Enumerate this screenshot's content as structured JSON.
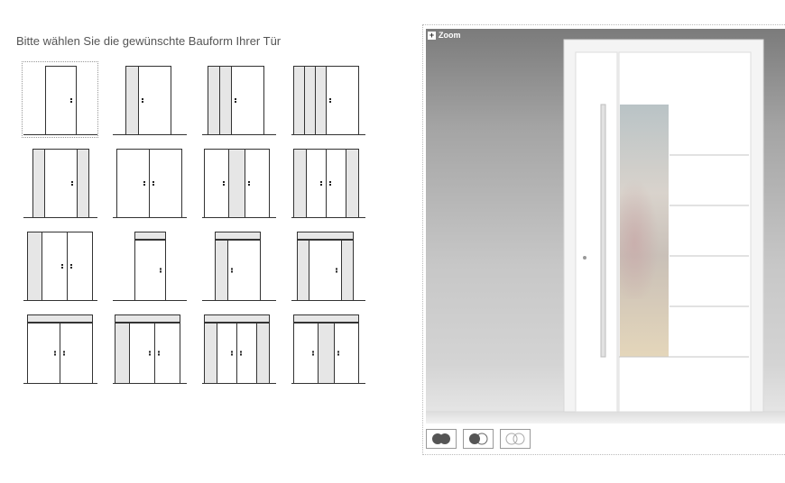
{
  "heading": "Bitte wählen Sie die gewünschte Bauform Ihrer Tür",
  "door_options": [
    {
      "id": "1-fluegel"
    },
    {
      "id": "1-fluegel-seitenteil-links"
    },
    {
      "id": "1-fluegel-2-seitenteile-links"
    },
    {
      "id": "1-fluegel-3-seitenteile-links"
    },
    {
      "id": "1-fluegel-2-seitenteile"
    },
    {
      "id": "2-fluegel"
    },
    {
      "id": "2-fluegel-mittelteil"
    },
    {
      "id": "2-fluegel-seitenteile"
    },
    {
      "id": "2-fluegel-seitenteil-links"
    },
    {
      "id": "1-fluegel-oberlicht"
    },
    {
      "id": "1-fluegel-seitenteil-oberlicht"
    },
    {
      "id": "1-fluegel-2-seitenteile-oberlicht"
    },
    {
      "id": "2-fluegel-oberlicht"
    },
    {
      "id": "2-fluegel-seitenteil-oberlicht"
    },
    {
      "id": "2-fluegel-2-seitenteile-oberlicht"
    },
    {
      "id": "2-fluegel-mittelteil-oberlicht"
    }
  ],
  "selected_index": 0,
  "preview": {
    "zoom_label": "Zoom",
    "thumbnails": [
      {
        "icon": "two-filled-circles-icon"
      },
      {
        "icon": "filled-and-outline-circle-icon"
      },
      {
        "icon": "two-outline-circles-icon"
      }
    ]
  },
  "colors": {
    "side_panel": "#e6e6e6",
    "door_line": "#333333",
    "door_fill": "#ffffff"
  }
}
